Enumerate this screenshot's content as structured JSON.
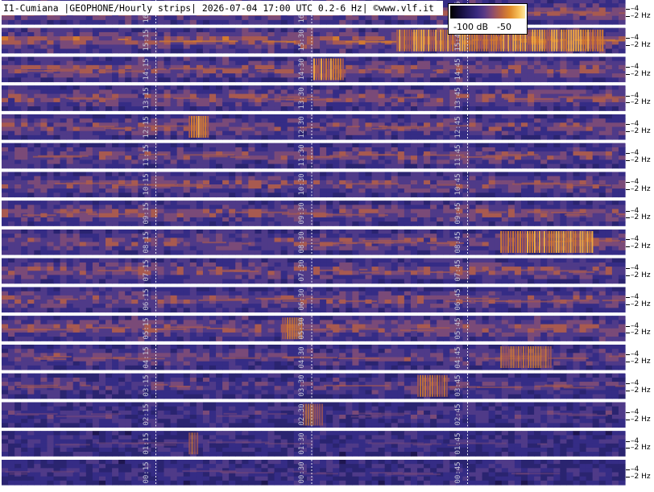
{
  "title": "I1-Cumiana |GEOPHONE/Hourly strips| 2026-07-04 17:00 UTC 0.2-6 Hz| ©www.vlf.it",
  "colorbar": {
    "min_label": "-100 dB",
    "max_label": "-50"
  },
  "chart_data": {
    "type": "heatmap",
    "title": "I1-Cumiana |GEOPHONE/Hourly strips| 2026-07-04 17:00 UTC 0.2-6 Hz| ©www.vlf.it",
    "color_scale": {
      "min_db": -100,
      "max_db": -50,
      "labels": [
        "-100 dB",
        "-50"
      ]
    },
    "y_axis": {
      "unit": "Hz",
      "tick_labels": [
        "4",
        "2 Hz"
      ],
      "range_hz": [
        0.2,
        6
      ]
    },
    "strip_order": "newest hour at top",
    "strips": [
      {
        "hour": 16,
        "time_labels": [
          "16:15",
          "16:30",
          "16:45"
        ]
      },
      {
        "hour": 15,
        "time_labels": [
          "15:15",
          "15:30",
          "15:45"
        ]
      },
      {
        "hour": 14,
        "time_labels": [
          "14:15",
          "14:30",
          "14:45"
        ]
      },
      {
        "hour": 13,
        "time_labels": [
          "13:15",
          "13:30",
          "13:45"
        ]
      },
      {
        "hour": 12,
        "time_labels": [
          "12:15",
          "12:30",
          "12:45"
        ]
      },
      {
        "hour": 11,
        "time_labels": [
          "11:15",
          "11:30",
          "11:45"
        ]
      },
      {
        "hour": 10,
        "time_labels": [
          "10:15",
          "10:30",
          "10:45"
        ]
      },
      {
        "hour": 9,
        "time_labels": [
          "09:15",
          "09:30",
          "09:45"
        ]
      },
      {
        "hour": 8,
        "time_labels": [
          "08:15",
          "08:30",
          "08:45"
        ]
      },
      {
        "hour": 7,
        "time_labels": [
          "07:15",
          "07:30",
          "07:45"
        ]
      },
      {
        "hour": 6,
        "time_labels": [
          "06:15",
          "06:30",
          "06:45"
        ]
      },
      {
        "hour": 5,
        "time_labels": [
          "05:15",
          "05:30",
          "05:45"
        ]
      },
      {
        "hour": 4,
        "time_labels": [
          "04:15",
          "04:30",
          "04:45"
        ]
      },
      {
        "hour": 3,
        "time_labels": [
          "03:15",
          "03:30",
          "03:45"
        ]
      },
      {
        "hour": 2,
        "time_labels": [
          "02:15",
          "02:30",
          "02:45"
        ]
      },
      {
        "hour": 1,
        "time_labels": [
          "01:15",
          "01:30",
          "01:45"
        ]
      },
      {
        "hour": 0,
        "time_labels": [
          "00:15",
          "00:30",
          "00:45"
        ]
      }
    ],
    "bright_events": [
      {
        "hour": 15,
        "start_min": 38,
        "end_min": 58,
        "intensity": 1.0
      },
      {
        "hour": 14,
        "start_min": 30,
        "end_min": 33,
        "intensity": 0.9
      },
      {
        "hour": 12,
        "start_min": 18,
        "end_min": 20,
        "intensity": 1.0
      },
      {
        "hour": 8,
        "start_min": 48,
        "end_min": 57,
        "intensity": 1.0
      },
      {
        "hour": 5,
        "start_min": 27,
        "end_min": 29,
        "intensity": 0.6
      },
      {
        "hour": 4,
        "start_min": 48,
        "end_min": 53,
        "intensity": 0.55
      },
      {
        "hour": 3,
        "start_min": 40,
        "end_min": 43,
        "intensity": 0.6
      },
      {
        "hour": 2,
        "start_min": 29,
        "end_min": 31,
        "intensity": 0.45
      },
      {
        "hour": 1,
        "start_min": 18,
        "end_min": 19,
        "intensity": 0.35
      }
    ],
    "strip_activity": [
      0.65,
      0.7,
      0.6,
      0.55,
      0.5,
      0.5,
      0.55,
      0.55,
      0.55,
      0.55,
      0.55,
      0.6,
      0.45,
      0.35,
      0.25,
      0.2,
      0.18
    ],
    "palette": [
      "#0a0820",
      "#1e1650",
      "#2a2470",
      "#352c85",
      "#4f3a88",
      "#7a4a78",
      "#a85a50",
      "#d27a30",
      "#f0a840",
      "#ffd88a"
    ]
  }
}
